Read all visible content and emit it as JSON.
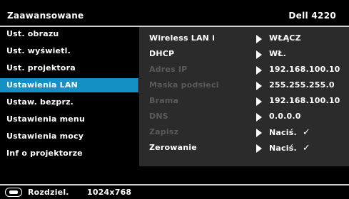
{
  "header": {
    "title": "Zaawansowane",
    "model": "Dell 4220"
  },
  "sidebar": {
    "items": [
      {
        "label": "Ust. obrazu"
      },
      {
        "label": "Ust. wyświetl."
      },
      {
        "label": "Ust. projektora"
      },
      {
        "label": "Ustawienia LAN"
      },
      {
        "label": "Ustaw. bezprz."
      },
      {
        "label": "Ustawienia menu"
      },
      {
        "label": "Ustawienia mocy"
      },
      {
        "label": "Inf o projektorze"
      }
    ],
    "active_index": 3
  },
  "panel": {
    "rows": [
      {
        "label": "Wireless LAN i",
        "value": "WŁĄCZ",
        "enabled": true
      },
      {
        "label": "DHCP",
        "value": "WŁ.",
        "enabled": true
      },
      {
        "label": "Adres IP",
        "value": "192.168.100.10",
        "enabled": false
      },
      {
        "label": "Maska podsieci",
        "value": "255.255.255.0",
        "enabled": false
      },
      {
        "label": "Brama",
        "value": "192.168.100.10",
        "enabled": false
      },
      {
        "label": "DNS",
        "value": "0.0.0.0",
        "enabled": false
      },
      {
        "label": "Zapisz",
        "value": "Naciś.",
        "check": "✓",
        "enabled": false
      },
      {
        "label": "Zerowanie",
        "value": "Naciś.",
        "check": "✓",
        "enabled": true
      }
    ]
  },
  "footer": {
    "resolution_label": "Rozdziel.",
    "resolution_value": "1024x768",
    "icon": "display-icon"
  },
  "colors": {
    "active_bg": "#1590c5",
    "panel_bg": "#2b2b2b",
    "disabled_text": "#5a5a5a"
  }
}
